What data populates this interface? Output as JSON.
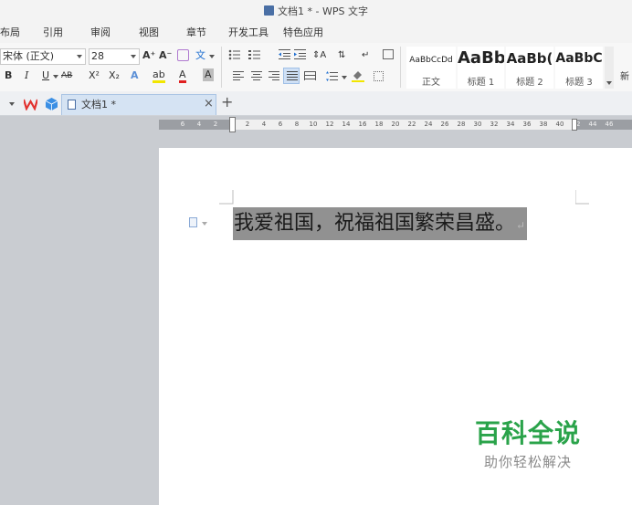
{
  "window": {
    "title": "文档1 * - WPS 文字"
  },
  "menu": [
    "布局",
    "引用",
    "审阅",
    "视图",
    "章节",
    "开发工具",
    "特色应用"
  ],
  "ribbon": {
    "font_name": "宋体 (正文)",
    "font_size": "28",
    "grow_font": "A⁺",
    "shrink_font": "A⁻",
    "bold": "B",
    "italic": "I",
    "underline": "U",
    "strike": "AB",
    "superscript": "X²",
    "subscript": "X₂",
    "text_effect": "A",
    "highlight": "ab",
    "font_color": "A",
    "char_shade": "A",
    "pinyin": "文",
    "styles": [
      {
        "sample": "AaBbCcDd",
        "name": "正文"
      },
      {
        "sample": "AaBb",
        "name": "标题 1"
      },
      {
        "sample": "AaBb(",
        "name": "标题 2"
      },
      {
        "sample": "AaBbC",
        "name": "标题 3"
      }
    ],
    "new_style": "新"
  },
  "tabs": {
    "doc_tab": "文档1 *",
    "close": "×",
    "new_tab": "+"
  },
  "ruler": {
    "left_numbers": [
      "6",
      "4",
      "2"
    ],
    "right_numbers": [
      "2",
      "4",
      "6",
      "8",
      "10",
      "12",
      "14",
      "16",
      "18",
      "20",
      "22",
      "24",
      "26",
      "28",
      "30",
      "32",
      "34",
      "36",
      "38",
      "40",
      "42",
      "44",
      "46"
    ]
  },
  "document": {
    "selected_text": "我爱祖国，祝福祖国繁荣昌盛。"
  },
  "watermark": {
    "title": "百科全说",
    "subtitle": "助你轻松解决"
  },
  "colors": {
    "selection": "#919191",
    "watermark_green": "#2aa34a",
    "active_tab": "#d5e3f3"
  }
}
